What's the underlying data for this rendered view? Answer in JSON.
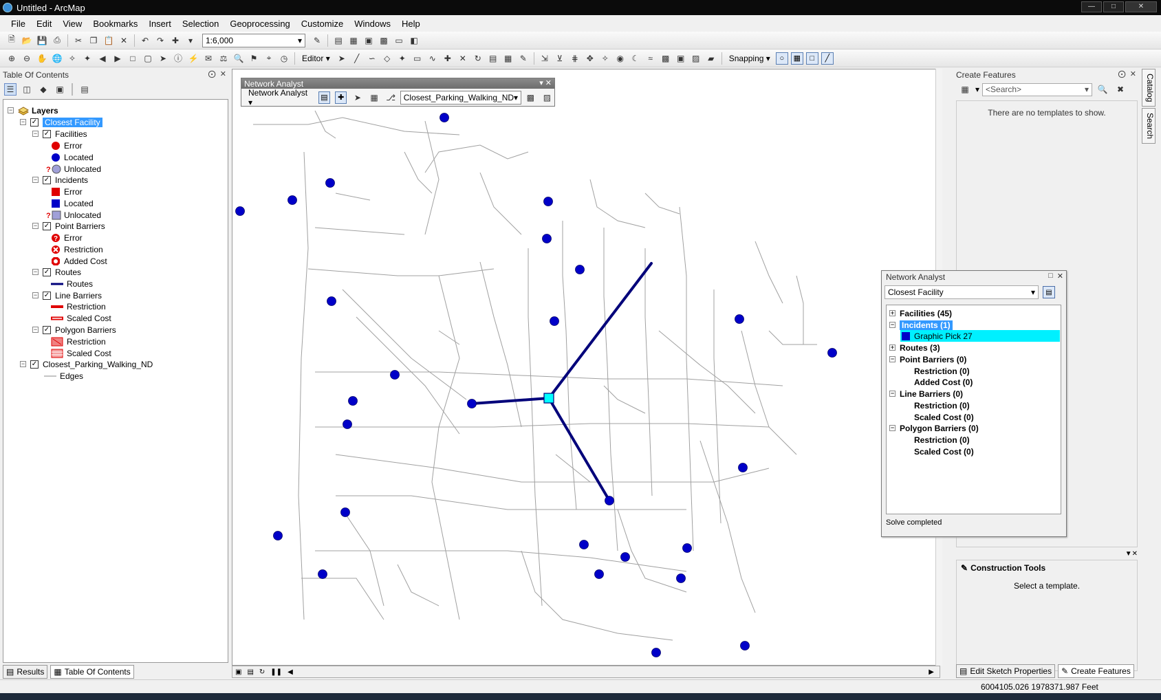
{
  "window": {
    "title": "Untitled - ArcMap"
  },
  "menu": [
    "File",
    "Edit",
    "View",
    "Bookmarks",
    "Insert",
    "Selection",
    "Geoprocessing",
    "Customize",
    "Windows",
    "Help"
  ],
  "toolbar": {
    "scale": "1:6,000",
    "editor_label": "Editor",
    "snapping_label": "Snapping"
  },
  "toc": {
    "title": "Table Of Contents",
    "root": "Layers",
    "group": "Closest Facility",
    "sublayers": [
      {
        "name": "Facilities",
        "items": [
          "Error",
          "Located",
          "Unlocated"
        ]
      },
      {
        "name": "Incidents",
        "items": [
          "Error",
          "Located",
          "Unlocated"
        ]
      },
      {
        "name": "Point Barriers",
        "items": [
          "Error",
          "Restriction",
          "Added Cost"
        ]
      },
      {
        "name": "Routes",
        "items": [
          "Routes"
        ]
      },
      {
        "name": "Line Barriers",
        "items": [
          "Restriction",
          "Scaled Cost"
        ]
      },
      {
        "name": "Polygon Barriers",
        "items": [
          "Restriction",
          "Scaled Cost"
        ]
      }
    ],
    "network_layer": "Closest_Parking_Walking_ND",
    "network_sub": "Edges",
    "tabs": [
      "Results",
      "Table Of Contents"
    ]
  },
  "na_toolbar": {
    "title": "Network Analyst",
    "menu_label": "Network Analyst",
    "dataset": "Closest_Parking_Walking_ND"
  },
  "create_features": {
    "title": "Create Features",
    "search_placeholder": "<Search>",
    "no_templates": "There are no templates to show.",
    "construction_title": "Construction Tools",
    "construction_msg": "Select a template.",
    "tabs": [
      "Edit Sketch Properties",
      "Create Features"
    ]
  },
  "right_dock": [
    "Catalog",
    "Search"
  ],
  "na_window": {
    "title": "Network Analyst",
    "analysis": "Closest Facility",
    "tree": {
      "facilities": "Facilities (45)",
      "incidents": "Incidents (1)",
      "graphic_pick": "Graphic Pick 27",
      "routes": "Routes (3)",
      "point_barriers": "Point Barriers (0)",
      "pb_restriction": "Restriction (0)",
      "pb_added_cost": "Added Cost (0)",
      "line_barriers": "Line Barriers (0)",
      "lb_restriction": "Restriction (0)",
      "lb_scaled_cost": "Scaled Cost (0)",
      "polygon_barriers": "Polygon Barriers (0)",
      "pgb_restriction": "Restriction (0)",
      "pgb_scaled_cost": "Scaled Cost (0)"
    },
    "status": "Solve completed"
  },
  "status": {
    "coords": "6004105.026  1978371.987 Feet"
  },
  "colors": {
    "facility": "#0000c8",
    "route": "#00007a",
    "incident": "#00ffff",
    "street": "#a0a0a0",
    "selection": "#3399ff"
  }
}
